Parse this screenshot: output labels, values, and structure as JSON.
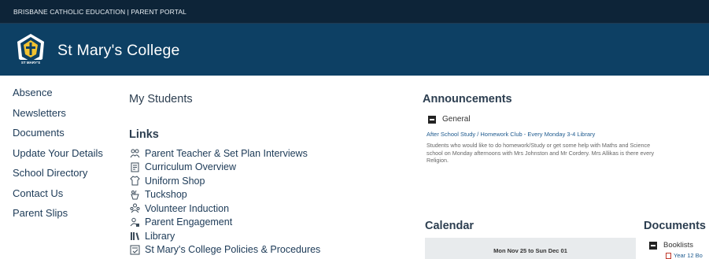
{
  "header": {
    "portal_label": "BRISBANE CATHOLIC EDUCATION | PARENT PORTAL",
    "college_name": "St Mary's College",
    "crest_text": "ST MARY'S"
  },
  "nav": {
    "items": [
      {
        "label": "Absence"
      },
      {
        "label": "Newsletters"
      },
      {
        "label": "Documents"
      },
      {
        "label": "Update Your Details"
      },
      {
        "label": "School Directory"
      },
      {
        "label": "Contact Us"
      },
      {
        "label": "Parent Slips"
      }
    ]
  },
  "students": {
    "heading": "My Students"
  },
  "links": {
    "heading": "Links",
    "items": [
      {
        "label": "Parent Teacher & Set Plan Interviews",
        "icon": "people-icon"
      },
      {
        "label": "Curriculum Overview",
        "icon": "document-icon"
      },
      {
        "label": "Uniform Shop",
        "icon": "shirt-icon"
      },
      {
        "label": "Tuckshop",
        "icon": "food-icon"
      },
      {
        "label": "Volunteer Induction",
        "icon": "group-icon"
      },
      {
        "label": "Parent Engagement",
        "icon": "person-badge-icon"
      },
      {
        "label": "Library",
        "icon": "books-icon"
      },
      {
        "label": "St Mary's College Policies & Procedures",
        "icon": "policy-icon"
      }
    ]
  },
  "announcements": {
    "heading": "Announcements",
    "category": "General",
    "title": "After School Study / Homework Club - Every Monday 3-4 Library",
    "body_lines": [
      "Students who would like to do homework/Study or get some help with Maths and Science",
      "school on Monday afternoons with Mrs Johnston and Mr Cordery. Mrs Allikas is there every",
      "Religion."
    ]
  },
  "calendar": {
    "heading": "Calendar",
    "range": "Mon Nov 25 to Sun Dec 01"
  },
  "documents": {
    "heading": "Documents",
    "category": "Booklists",
    "sub_item": "Year 12 Bo"
  },
  "colors": {
    "topbar": "#0d2438",
    "banner": "#0d4064",
    "link": "#1c3a57"
  }
}
